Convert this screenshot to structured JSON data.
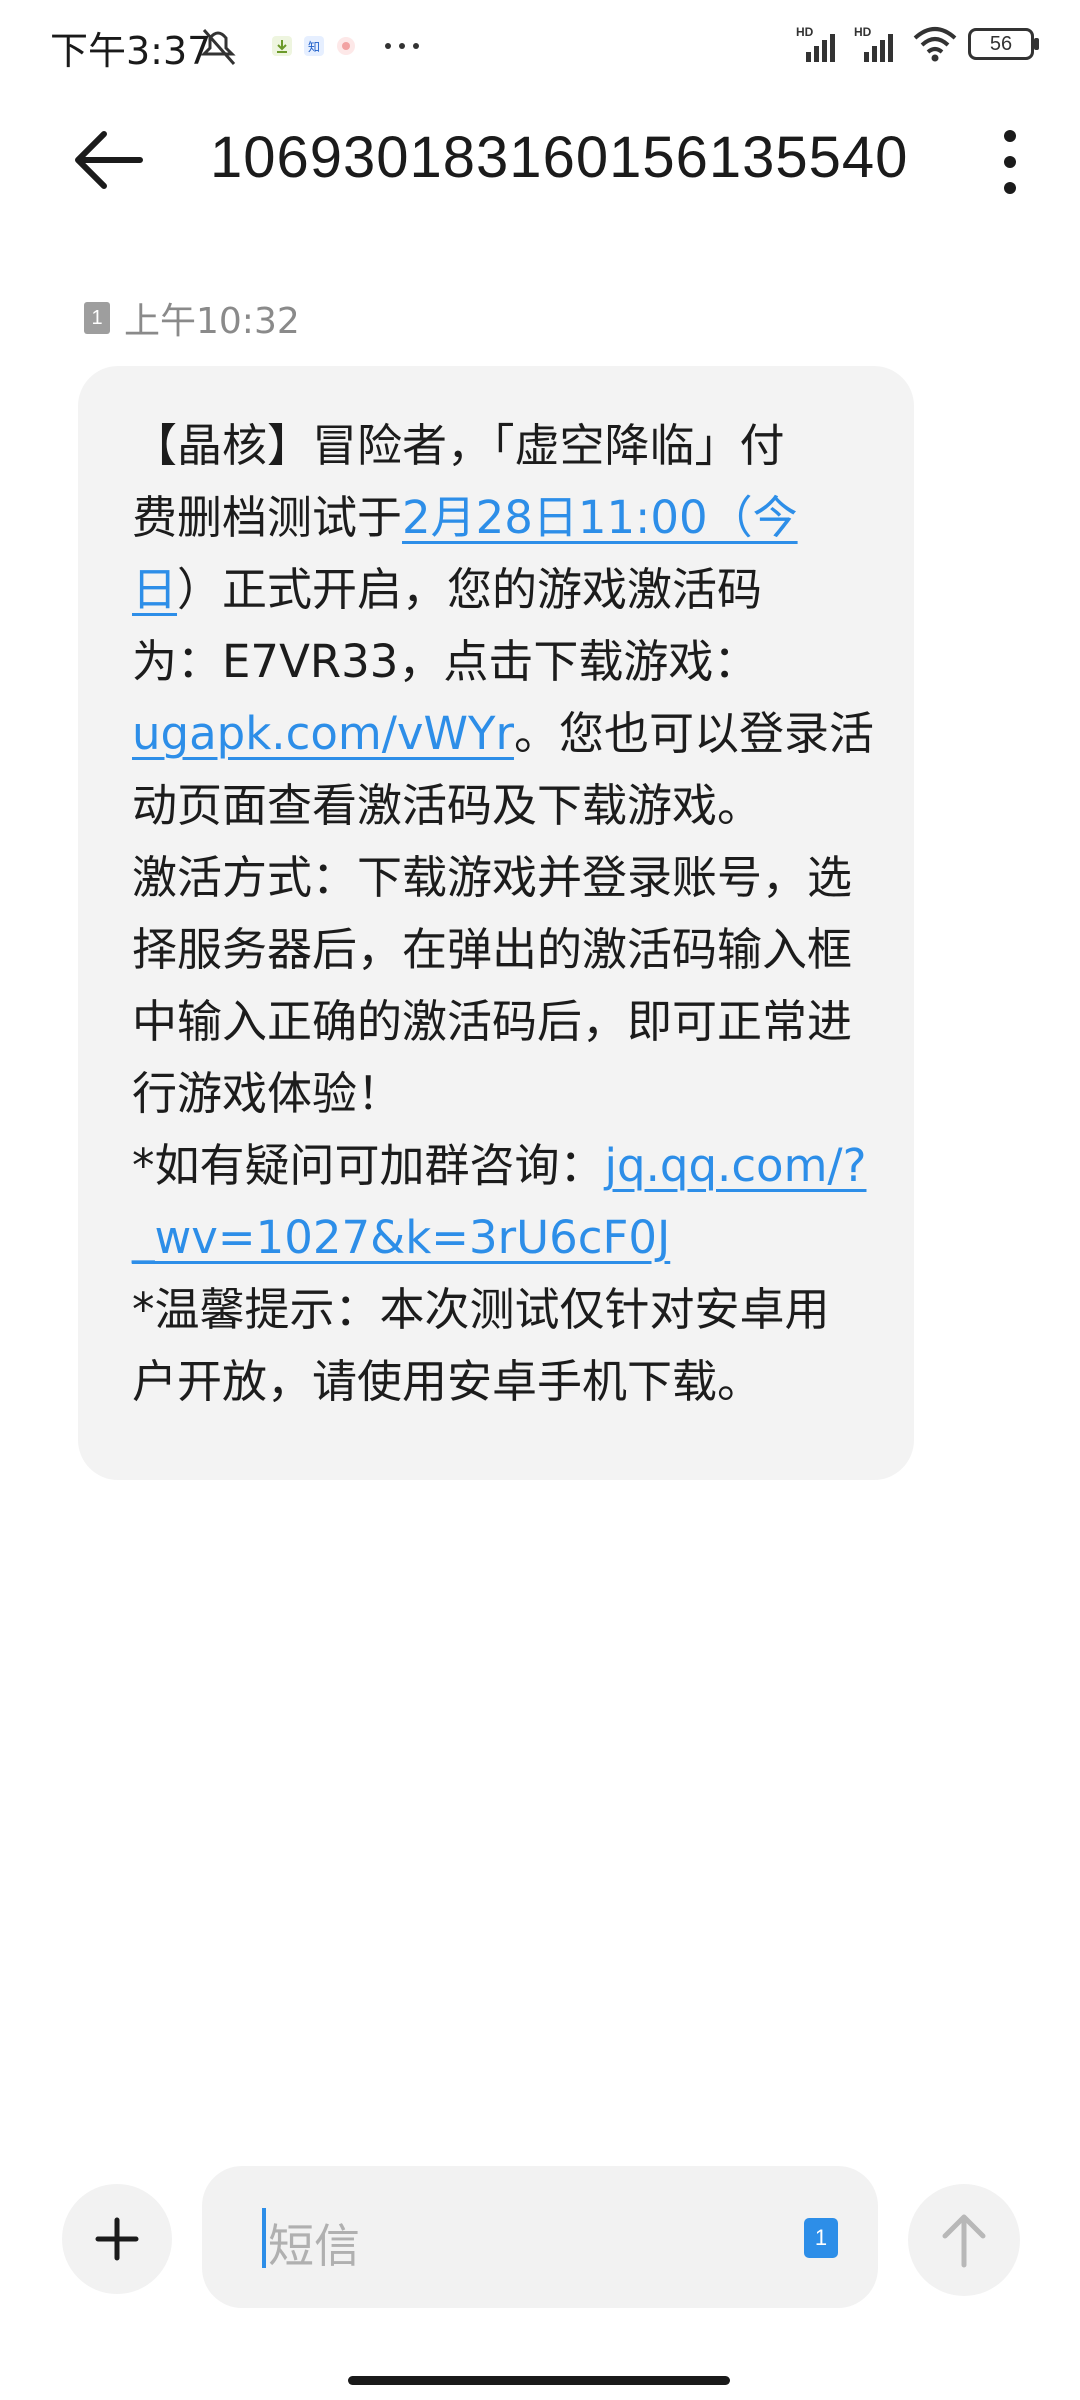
{
  "status_bar": {
    "time": "下午3:37",
    "battery": "56",
    "network_labels": [
      "HD",
      "HD"
    ]
  },
  "header": {
    "title": "106930183160156135540"
  },
  "message": {
    "sim_slot": "1",
    "time": "上午10:32",
    "lines": [
      {
        "parts": [
          {
            "t": "【晶核】冒险者，「虚空降临」付"
          }
        ]
      },
      {
        "parts": [
          {
            "t": "费删档测试于"
          },
          {
            "t": "2月28日11:00（今",
            "link": true
          }
        ]
      },
      {
        "parts": [
          {
            "t": "日",
            "link": true
          },
          {
            "t": "）正式开启，您的游戏激活码"
          }
        ]
      },
      {
        "parts": [
          {
            "t": "为：E7VR33，点击下载游戏："
          }
        ]
      },
      {
        "parts": [
          {
            "t": "ugapk.com/vWYr",
            "link": true
          },
          {
            "t": "。您也可以登录活"
          }
        ]
      },
      {
        "parts": [
          {
            "t": "动页面查看激活码及下载游戏。"
          }
        ]
      },
      {
        "parts": [
          {
            "t": "激活方式：下载游戏并登录账号，选"
          }
        ]
      },
      {
        "parts": [
          {
            "t": "择服务器后，在弹出的激活码输入框"
          }
        ]
      },
      {
        "parts": [
          {
            "t": "中输入正确的激活码后，即可正常进"
          }
        ]
      },
      {
        "parts": [
          {
            "t": "行游戏体验！"
          }
        ]
      },
      {
        "parts": [
          {
            "t": "*如有疑问可加群咨询："
          },
          {
            "t": "jq.qq.com/?",
            "link": true
          }
        ]
      },
      {
        "parts": [
          {
            "t": "_wv=1027&k=3rU6cF0J",
            "link": true
          }
        ]
      },
      {
        "parts": [
          {
            "t": "*温馨提示：本次测试仅针对安卓用"
          }
        ]
      },
      {
        "parts": [
          {
            "t": "户开放，请使用安卓手机下载。"
          }
        ]
      }
    ]
  },
  "composer": {
    "placeholder": "短信",
    "sim_badge": "1"
  },
  "colors": {
    "accent": "#2d8ee8",
    "bubble": "#f3f3f3",
    "muted": "#8a8a8a"
  },
  "icons": {
    "back": "arrow-left-icon",
    "more": "more-vertical-icon",
    "add": "plus-icon",
    "send": "arrow-up-icon"
  }
}
